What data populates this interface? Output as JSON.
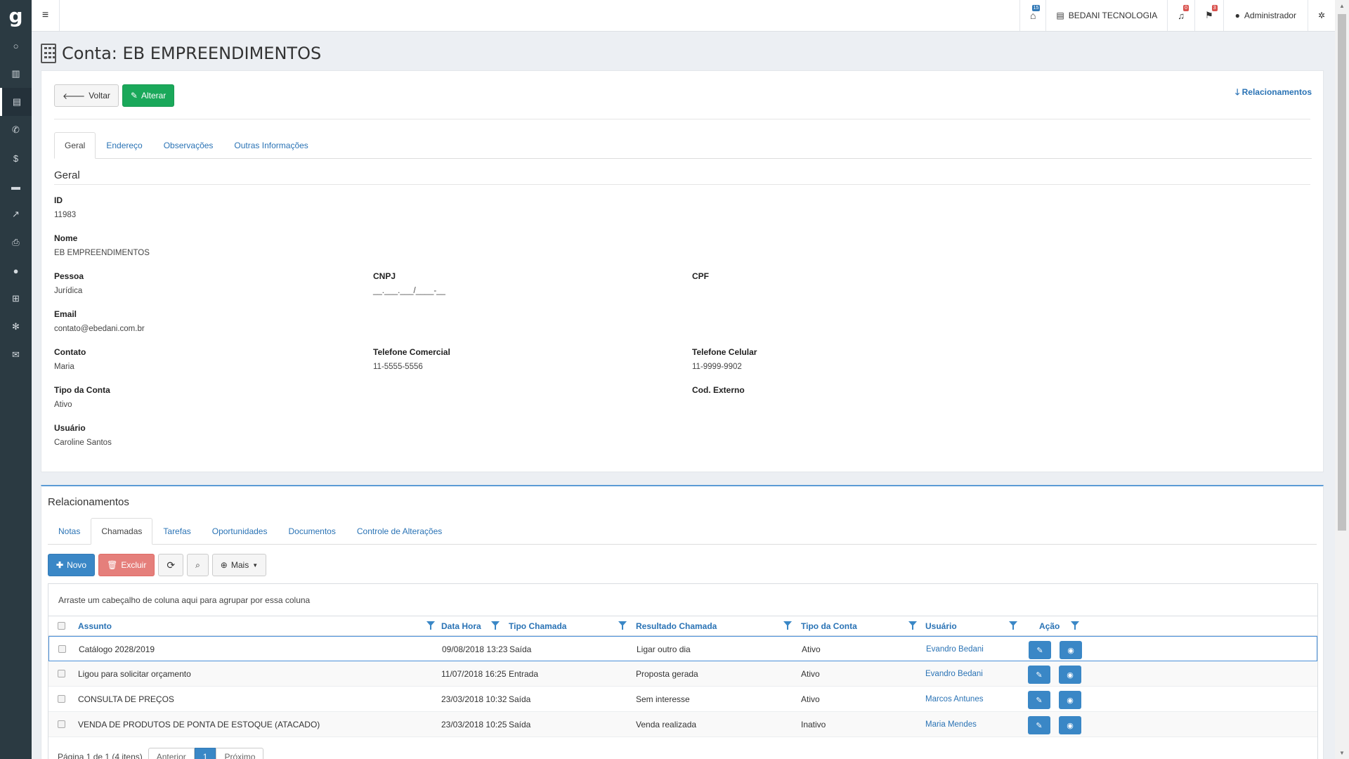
{
  "sidebar": {
    "logo": "g",
    "items": [
      {
        "icon": "circle-icon",
        "glyph": "○"
      },
      {
        "icon": "bar-chart-icon",
        "glyph": "▥"
      },
      {
        "icon": "building-icon",
        "glyph": "▤"
      },
      {
        "icon": "phone-icon",
        "glyph": "✆"
      },
      {
        "icon": "dollar-icon",
        "glyph": "$"
      },
      {
        "icon": "card-icon",
        "glyph": "▬"
      },
      {
        "icon": "line-chart-icon",
        "glyph": "↗"
      },
      {
        "icon": "print-icon",
        "glyph": "⎙"
      },
      {
        "icon": "user-icon",
        "glyph": "●"
      },
      {
        "icon": "grid-icon",
        "glyph": "⊞"
      },
      {
        "icon": "gear-icon",
        "glyph": "✻"
      },
      {
        "icon": "comments-icon",
        "glyph": "✉"
      }
    ]
  },
  "topbar": {
    "bank_badge": "15",
    "company": "BEDANI TECNOLOGIA",
    "bell_badge": "0",
    "flag_badge": "3",
    "user": "Administrador"
  },
  "page": {
    "title": "Conta: EB EMPREENDIMENTOS",
    "back_label": "Voltar",
    "edit_label": "Alterar",
    "relations_link": "Relacionamentos",
    "tabs": [
      "Geral",
      "Endereço",
      "Observações",
      "Outras Informações"
    ],
    "section": "Geral"
  },
  "fields": {
    "id_label": "ID",
    "id_value": "11983",
    "nome_label": "Nome",
    "nome_value": "EB EMPREENDIMENTOS",
    "pessoa_label": "Pessoa",
    "pessoa_value": "Jurídica",
    "cnpj_label": "CNPJ",
    "cnpj_value": "__.___.___/____-__",
    "cpf_label": "CPF",
    "email_label": "Email",
    "email_value": "contato@ebedani.com.br",
    "contato_label": "Contato",
    "contato_value": "Maria",
    "tel_com_label": "Telefone Comercial",
    "tel_com_value": "11-5555-5556",
    "tel_cel_label": "Telefone Celular",
    "tel_cel_value": "11-9999-9902",
    "tipo_label": "Tipo da Conta",
    "tipo_value": "Ativo",
    "cod_label": "Cod. Externo",
    "usuario_label": "Usuário",
    "usuario_value": "Caroline Santos"
  },
  "relations": {
    "title": "Relacionamentos",
    "tabs": [
      "Notas",
      "Chamadas",
      "Tarefas",
      "Oportunidades",
      "Documentos",
      "Controle de Alterações"
    ],
    "active_tab": "Chamadas",
    "toolbar": {
      "new_label": "Novo",
      "delete_label": "Excluir",
      "more_label": "Mais"
    },
    "group_hint": "Arraste um cabeçalho de coluna aqui para agrupar por essa coluna",
    "columns": [
      "Assunto",
      "Data Hora",
      "Tipo Chamada",
      "Resultado Chamada",
      "Tipo da Conta",
      "Usuário",
      "Ação"
    ],
    "rows": [
      {
        "assunto": "Catálogo 2028/2019",
        "data": "09/08/2018 13:23",
        "tipo": "Saída",
        "resultado": "Ligar outro dia",
        "conta": "Ativo",
        "usuario": "Evandro Bedani"
      },
      {
        "assunto": "Ligou para solicitar orçamento",
        "data": "11/07/2018 16:25",
        "tipo": "Entrada",
        "resultado": "Proposta gerada",
        "conta": "Ativo",
        "usuario": "Evandro Bedani"
      },
      {
        "assunto": "CONSULTA DE PREÇOS",
        "data": "23/03/2018 10:32",
        "tipo": "Saída",
        "resultado": "Sem interesse",
        "conta": "Ativo",
        "usuario": "Marcos Antunes"
      },
      {
        "assunto": "VENDA DE PRODUTOS DE PONTA DE ESTOQUE (ATACADO)",
        "data": "23/03/2018 10:25",
        "tipo": "Saída",
        "resultado": "Venda realizada",
        "conta": "Inativo",
        "usuario": "Maria Mendes"
      }
    ],
    "pager": {
      "info": "Página 1 de 1 (4 itens)",
      "prev": "Anterior",
      "page": "1",
      "next": "Próximo"
    }
  }
}
